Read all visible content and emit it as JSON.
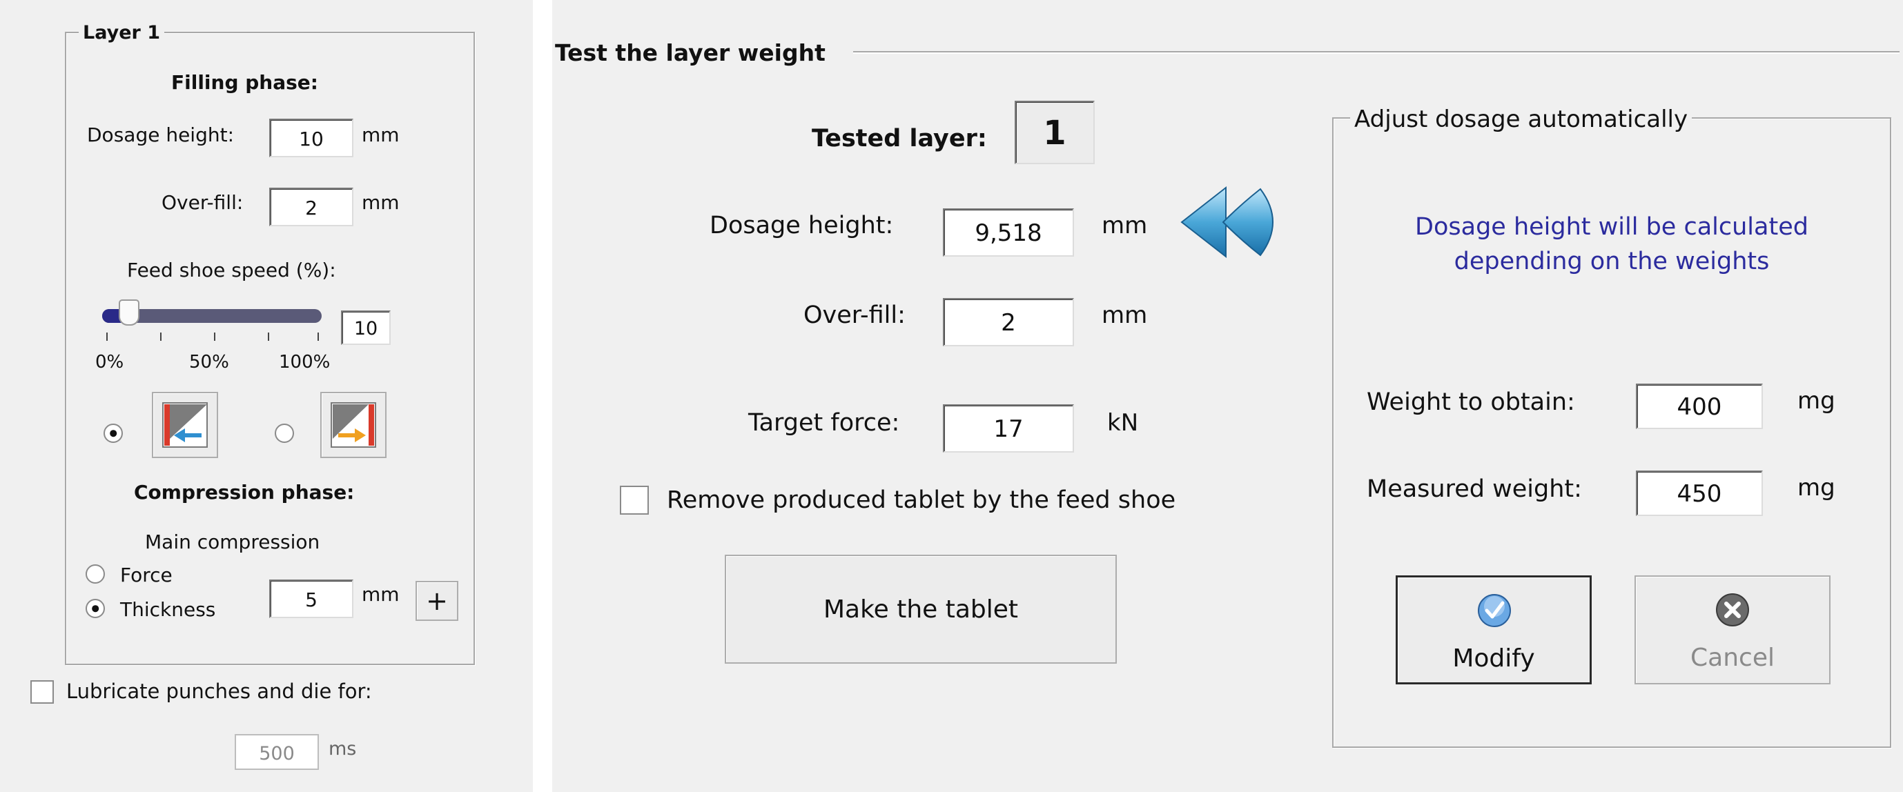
{
  "left_panel": {
    "layer_group_title": "Layer 1",
    "filling_phase_heading": "Filling phase:",
    "dosage_height_label": "Dosage height:",
    "dosage_height_value": "10",
    "dosage_height_unit": "mm",
    "overfill_label": "Over-fill:",
    "overfill_value": "2",
    "overfill_unit": "mm",
    "feed_shoe_speed_label": "Feed shoe speed (%):",
    "feed_shoe_speed_value": "10",
    "feed_shoe_speed_level": 0.1,
    "slider_ticks": [
      "0%",
      "50%",
      "100%"
    ],
    "feed_direction_left_selected": true,
    "compression_phase_heading": "Compression phase:",
    "main_compression_label": "Main compression",
    "force_option_label": "Force",
    "thickness_option_label": "Thickness",
    "thickness_selected": true,
    "thickness_value": "5",
    "thickness_unit": "mm",
    "add_button_label": "+",
    "lubricate_label": "Lubricate punches and die for:",
    "lubricate_checked": false,
    "lubricate_value": "500",
    "lubricate_unit": "ms"
  },
  "right_panel": {
    "section_title": "Test the layer weight",
    "tested_layer_label": "Tested layer:",
    "tested_layer_value": "1",
    "dosage_height_label": "Dosage height:",
    "dosage_height_value": "9,518",
    "dosage_height_unit": "mm",
    "overfill_label": "Over-fill:",
    "overfill_value": "2",
    "overfill_unit": "mm",
    "target_force_label": "Target force:",
    "target_force_value": "17",
    "target_force_unit": "kN",
    "remove_tablet_label": "Remove produced tablet by the feed shoe",
    "remove_tablet_checked": false,
    "make_tablet_button": "Make the tablet",
    "adjust_group_title": "Adjust dosage automatically",
    "adjust_info_line1": "Dosage height will be calculated",
    "adjust_info_line2": "depending on the weights",
    "info_text_color": "#2b2b9e",
    "weight_to_obtain_label": "Weight to obtain:",
    "weight_to_obtain_value": "400",
    "weight_to_obtain_unit": "mg",
    "measured_weight_label": "Measured weight:",
    "measured_weight_value": "450",
    "measured_weight_unit": "mg",
    "modify_button": "Modify",
    "cancel_button": "Cancel"
  },
  "icons": {
    "rewind": "rewind-icon",
    "feed_left": "feed-shoe-left-icon",
    "feed_right": "feed-shoe-right-icon",
    "modify": "check-circle-icon",
    "cancel": "cancel-circle-icon"
  }
}
